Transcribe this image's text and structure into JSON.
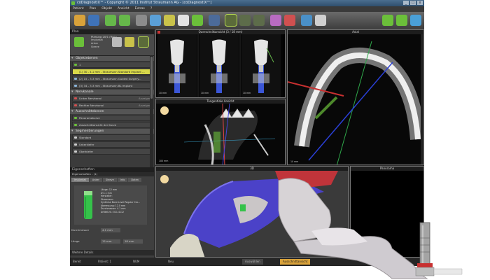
{
  "window": {
    "title": "coDiagnostiX™ - Copyright © 2011 Institut Straumann AG - [coDiagnostiX™]",
    "controls": [
      "_",
      "□",
      "x"
    ]
  },
  "menubar": {
    "items": [
      "Patient",
      "Plan",
      "Objekt",
      "Ansicht",
      "Extras",
      "?"
    ]
  },
  "left_panel": {
    "header": "Plan",
    "top_label": "Planung 20/1 (R01)",
    "top_sub": [
      "Implantat",
      "Anker",
      "Sleeve"
    ],
    "scrollbar": "scrollbar",
    "sections": [
      {
        "title": "Objektebenen",
        "rows": [
          {
            "text": "1",
            "color": "#6bbf3a",
            "right": ""
          },
          {
            "text": "(1) 30 - 4.1 mm - Straumann Standard Implant ...",
            "color": "#d9d94a",
            "right": "",
            "highlight": true
          },
          {
            "text": "(2) 15 - 3.3 mm - Straumann Guided Surgery...",
            "color": "#8ab4d8",
            "right": ""
          },
          {
            "text": "(3) 34 - 3.3 mm - Straumann BL Implant",
            "color": "#8ab4d8",
            "right": ""
          }
        ]
      },
      {
        "title": "Nervkanale",
        "rows": [
          {
            "text": "Linker Nervkanal",
            "color": "#d05050",
            "right": "Anzeigen"
          },
          {
            "text": "Rechter Nervkanal",
            "color": "#d05050",
            "right": "Anzeigen"
          }
        ]
      },
      {
        "title": "Ausschnittebenen",
        "rows": [
          {
            "text": "Panoramakurve",
            "color": "#6bbf3a",
            "right": ""
          },
          {
            "text": "Ausschnittansicht der Kurve",
            "color": "#6bbf3a",
            "right": ""
          }
        ]
      },
      {
        "title": "Segmentierungen",
        "rows": [
          {
            "text": "Standard",
            "color": "#cccccc",
            "right": ""
          },
          {
            "text": "Unterkiefer",
            "color": "#cccccc",
            "right": ""
          },
          {
            "text": "Oberkiefer",
            "color": "#cccccc",
            "right": ""
          }
        ]
      }
    ],
    "bottom_header": "Eigenschaften",
    "props_header": "Eigenschaften - (1)",
    "props_tabs": [
      "Implantat",
      "Anker",
      "Sleeve",
      "Info",
      "Daten"
    ],
    "implant_specs": [
      "Länge: 12 mm",
      "Ø 4.1 mm",
      "Hersteller:",
      "Straumann",
      "Synthese Bone Level Regular Cro...",
      "Abmessung: 12.0 mm",
      "Durchmesser: 4.1 mm",
      "Artikel-Nr.: 021.4112"
    ],
    "field_rows": [
      {
        "label": "Durchmesser",
        "value1": "4.1 mm",
        "value2": ""
      },
      {
        "label": "Länge",
        "value1": "12 mm",
        "value2": "18 mm"
      }
    ],
    "footer_label": "Weitere Details"
  },
  "toolbar": {
    "icons": [
      "folder-open-icon",
      "save-icon",
      "undo-icon",
      "redo-icon",
      "implant-icon",
      "anchor-pin-icon",
      "sleeve-icon",
      "tooth-icon",
      "measure-icon",
      "grid-icon",
      "view-2d-icon",
      "view-3d-icon",
      "view-split-icon",
      "segmentation-icon",
      "nerve-icon",
      "zoom-icon",
      "reset-icon",
      "prev-icon",
      "next-icon",
      "help-icon"
    ],
    "active_index": 10
  },
  "views": {
    "tangential": {
      "title": "Querschnittansicht (3 / 18 mm)",
      "scale": [
        "10 mm",
        "10 mm",
        "10 mm"
      ]
    },
    "sagittal": {
      "title": "Tangentiale Ansicht",
      "scale": "100 mm"
    },
    "axial": {
      "title": "Axial",
      "scale": "10 mm"
    },
    "render3d": {
      "title": "3D"
    },
    "panorama": {
      "title": "Panorama"
    }
  },
  "statusbar": {
    "left": "Bereit",
    "patient": "Patient: 1",
    "ready": "NUM",
    "mid": "Neu",
    "right_btn": "Auswählen",
    "right_badge": "Ausschnittansicht"
  },
  "colors": {
    "app_bg": "#2e2e2e",
    "highlight": "#d9d94a",
    "implant_green": "#35c24a",
    "bone": "#d8d5c6",
    "mandible_blue": "#4b42c8",
    "gum_red": "#c0343a"
  }
}
